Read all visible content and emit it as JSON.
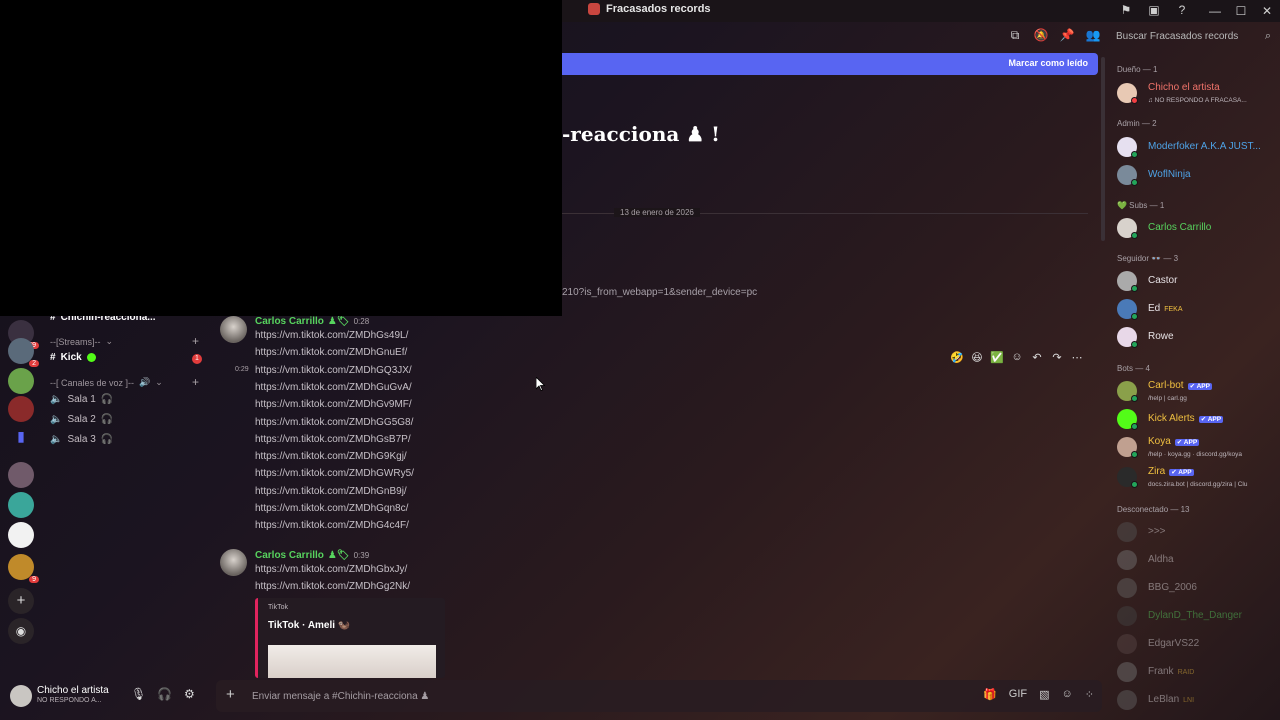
{
  "window": {
    "title": "Fracasados records",
    "controls": [
      "—",
      "☐",
      "✕"
    ],
    "toolbar_icons": [
      "inbox-icon",
      "window-icon",
      "help-icon"
    ]
  },
  "header": {
    "search_placeholder": "Buscar Fracasados records",
    "icons": [
      "threads-icon",
      "mute-icon",
      "pin-icon",
      "members-icon"
    ]
  },
  "unread_bar": {
    "mark_read": "Marcar como leído"
  },
  "channel_welcome": {
    "title_visible": "-reacciona ♟ !"
  },
  "divider_date": "13 de enero de 2026",
  "link_tail": "210?is_from_webapp=1&sender_device=pc",
  "channels": {
    "top_channel": "Chichin-reacciona...",
    "category_streams": "--[Streams]--",
    "kick": "Kick",
    "kick_badge": "1",
    "category_voice": "--[ Canales de voz ]--",
    "voice": [
      "Sala 1",
      "Sala 2",
      "Sala 3"
    ]
  },
  "servers": {
    "badge_top": "69",
    "badge_mid": "2",
    "badge_low": "9"
  },
  "user_panel": {
    "name": "Chicho el artista",
    "status": "NO RESPONDO A..."
  },
  "messages": [
    {
      "author": "Carlos Carrillo",
      "time": "0:28",
      "side_time": "0:29",
      "links": [
        "https://vm.tiktok.com/ZMDhGs49L/",
        "https://vm.tiktok.com/ZMDhGnuEf/",
        "https://vm.tiktok.com/ZMDhGQ3JX/",
        "https://vm.tiktok.com/ZMDhGuGvA/",
        "https://vm.tiktok.com/ZMDhGv9MF/",
        "https://vm.tiktok.com/ZMDhGG5G8/",
        "https://vm.tiktok.com/ZMDhGsB7P/",
        "https://vm.tiktok.com/ZMDhG9Kgj/",
        "https://vm.tiktok.com/ZMDhGWRy5/",
        "https://vm.tiktok.com/ZMDhGnB9j/",
        "https://vm.tiktok.com/ZMDhGqn8c/",
        "https://vm.tiktok.com/ZMDhG4c4F/"
      ]
    },
    {
      "author": "Carlos Carrillo",
      "time": "0:39",
      "links": [
        "https://vm.tiktok.com/ZMDhGbxJy/",
        "https://vm.tiktok.com/ZMDhGg2Nk/"
      ],
      "embed": {
        "provider": "TikTok",
        "title": "TikTok · Ameli 🦦"
      }
    }
  ],
  "composer": {
    "placeholder": "Enviar mensaje a #Chichin-reacciona ♟"
  },
  "members": {
    "groups": [
      {
        "label": "Dueño — 1"
      },
      {
        "label": "Admin — 2"
      },
      {
        "label": "💚 Subs — 1"
      },
      {
        "label": "Seguidor 👓 — 3"
      },
      {
        "label": "Bots — 4"
      },
      {
        "label": "Desconectado — 13"
      }
    ],
    "list": [
      {
        "name": "Chicho el artista",
        "sub": "♫ NO RESPONDO A FRACASA...",
        "color": "#f0736a"
      },
      {
        "name": "Moderfoker A.K.A JUST...",
        "color": "#4ea2e6"
      },
      {
        "name": "WoflNinja",
        "color": "#4ea2e6"
      },
      {
        "name": "Carlos Carrillo",
        "color": "#57d35e"
      },
      {
        "name": "Castor",
        "color": "#e6e1e4"
      },
      {
        "name": "Ed",
        "tag": "FEKA",
        "color": "#e6e1e4"
      },
      {
        "name": "Rowe",
        "color": "#e6e1e4"
      },
      {
        "name": "Carl-bot",
        "sub": "/help | carl.gg",
        "color": "#f0c040"
      },
      {
        "name": "Kick Alerts",
        "color": "#f0c040"
      },
      {
        "name": "Koya",
        "sub": "/help · koya.gg · discord.gg/koya",
        "color": "#f0c040"
      },
      {
        "name": "Zira",
        "sub": "docs.zira.bot | discord.gg/zira | Clu",
        "color": "#f0c040"
      },
      {
        "name": ">>>",
        "color": "#e6e1e4"
      },
      {
        "name": "Aldha",
        "color": "#e6e1e4"
      },
      {
        "name": "BBG_2006",
        "color": "#e6e1e4"
      },
      {
        "name": "DylanD_The_Danger",
        "color": "#57d35e"
      },
      {
        "name": "EdgarVS22",
        "color": "#e6e1e4"
      },
      {
        "name": "Frank",
        "tag": "RAID",
        "color": "#e6e1e4"
      },
      {
        "name": "LeBlan",
        "tag": "LNI",
        "color": "#e6e1e4"
      }
    ],
    "app_badge": "✔ APP"
  }
}
